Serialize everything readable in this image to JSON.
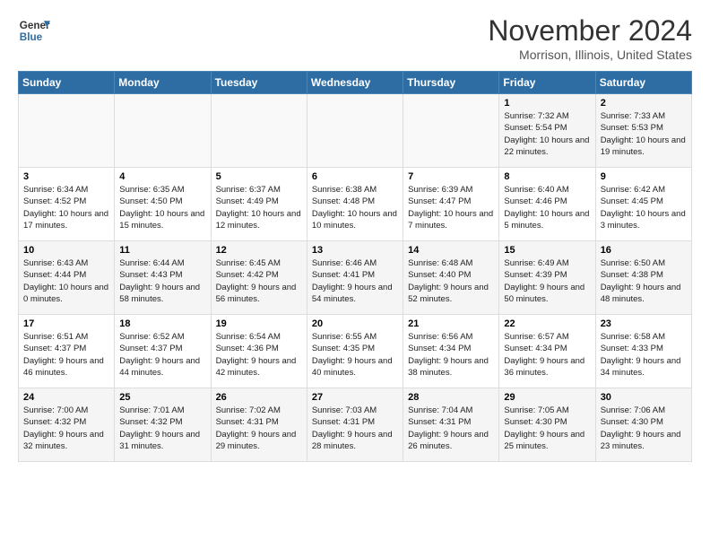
{
  "header": {
    "logo_line1": "General",
    "logo_line2": "Blue",
    "month": "November 2024",
    "location": "Morrison, Illinois, United States"
  },
  "weekdays": [
    "Sunday",
    "Monday",
    "Tuesday",
    "Wednesday",
    "Thursday",
    "Friday",
    "Saturday"
  ],
  "rows": [
    [
      {
        "day": "",
        "info": ""
      },
      {
        "day": "",
        "info": ""
      },
      {
        "day": "",
        "info": ""
      },
      {
        "day": "",
        "info": ""
      },
      {
        "day": "",
        "info": ""
      },
      {
        "day": "1",
        "info": "Sunrise: 7:32 AM\nSunset: 5:54 PM\nDaylight: 10 hours and 22 minutes."
      },
      {
        "day": "2",
        "info": "Sunrise: 7:33 AM\nSunset: 5:53 PM\nDaylight: 10 hours and 19 minutes."
      }
    ],
    [
      {
        "day": "3",
        "info": "Sunrise: 6:34 AM\nSunset: 4:52 PM\nDaylight: 10 hours and 17 minutes."
      },
      {
        "day": "4",
        "info": "Sunrise: 6:35 AM\nSunset: 4:50 PM\nDaylight: 10 hours and 15 minutes."
      },
      {
        "day": "5",
        "info": "Sunrise: 6:37 AM\nSunset: 4:49 PM\nDaylight: 10 hours and 12 minutes."
      },
      {
        "day": "6",
        "info": "Sunrise: 6:38 AM\nSunset: 4:48 PM\nDaylight: 10 hours and 10 minutes."
      },
      {
        "day": "7",
        "info": "Sunrise: 6:39 AM\nSunset: 4:47 PM\nDaylight: 10 hours and 7 minutes."
      },
      {
        "day": "8",
        "info": "Sunrise: 6:40 AM\nSunset: 4:46 PM\nDaylight: 10 hours and 5 minutes."
      },
      {
        "day": "9",
        "info": "Sunrise: 6:42 AM\nSunset: 4:45 PM\nDaylight: 10 hours and 3 minutes."
      }
    ],
    [
      {
        "day": "10",
        "info": "Sunrise: 6:43 AM\nSunset: 4:44 PM\nDaylight: 10 hours and 0 minutes."
      },
      {
        "day": "11",
        "info": "Sunrise: 6:44 AM\nSunset: 4:43 PM\nDaylight: 9 hours and 58 minutes."
      },
      {
        "day": "12",
        "info": "Sunrise: 6:45 AM\nSunset: 4:42 PM\nDaylight: 9 hours and 56 minutes."
      },
      {
        "day": "13",
        "info": "Sunrise: 6:46 AM\nSunset: 4:41 PM\nDaylight: 9 hours and 54 minutes."
      },
      {
        "day": "14",
        "info": "Sunrise: 6:48 AM\nSunset: 4:40 PM\nDaylight: 9 hours and 52 minutes."
      },
      {
        "day": "15",
        "info": "Sunrise: 6:49 AM\nSunset: 4:39 PM\nDaylight: 9 hours and 50 minutes."
      },
      {
        "day": "16",
        "info": "Sunrise: 6:50 AM\nSunset: 4:38 PM\nDaylight: 9 hours and 48 minutes."
      }
    ],
    [
      {
        "day": "17",
        "info": "Sunrise: 6:51 AM\nSunset: 4:37 PM\nDaylight: 9 hours and 46 minutes."
      },
      {
        "day": "18",
        "info": "Sunrise: 6:52 AM\nSunset: 4:37 PM\nDaylight: 9 hours and 44 minutes."
      },
      {
        "day": "19",
        "info": "Sunrise: 6:54 AM\nSunset: 4:36 PM\nDaylight: 9 hours and 42 minutes."
      },
      {
        "day": "20",
        "info": "Sunrise: 6:55 AM\nSunset: 4:35 PM\nDaylight: 9 hours and 40 minutes."
      },
      {
        "day": "21",
        "info": "Sunrise: 6:56 AM\nSunset: 4:34 PM\nDaylight: 9 hours and 38 minutes."
      },
      {
        "day": "22",
        "info": "Sunrise: 6:57 AM\nSunset: 4:34 PM\nDaylight: 9 hours and 36 minutes."
      },
      {
        "day": "23",
        "info": "Sunrise: 6:58 AM\nSunset: 4:33 PM\nDaylight: 9 hours and 34 minutes."
      }
    ],
    [
      {
        "day": "24",
        "info": "Sunrise: 7:00 AM\nSunset: 4:32 PM\nDaylight: 9 hours and 32 minutes."
      },
      {
        "day": "25",
        "info": "Sunrise: 7:01 AM\nSunset: 4:32 PM\nDaylight: 9 hours and 31 minutes."
      },
      {
        "day": "26",
        "info": "Sunrise: 7:02 AM\nSunset: 4:31 PM\nDaylight: 9 hours and 29 minutes."
      },
      {
        "day": "27",
        "info": "Sunrise: 7:03 AM\nSunset: 4:31 PM\nDaylight: 9 hours and 28 minutes."
      },
      {
        "day": "28",
        "info": "Sunrise: 7:04 AM\nSunset: 4:31 PM\nDaylight: 9 hours and 26 minutes."
      },
      {
        "day": "29",
        "info": "Sunrise: 7:05 AM\nSunset: 4:30 PM\nDaylight: 9 hours and 25 minutes."
      },
      {
        "day": "30",
        "info": "Sunrise: 7:06 AM\nSunset: 4:30 PM\nDaylight: 9 hours and 23 minutes."
      }
    ]
  ]
}
